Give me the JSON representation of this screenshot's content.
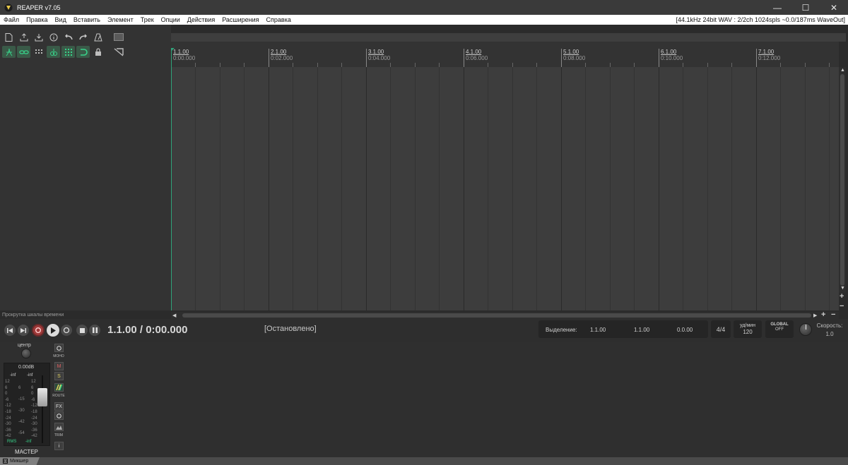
{
  "window": {
    "title": "REAPER v7.05",
    "controls": {
      "minimize": "—",
      "maximize": "☐",
      "close": "✕"
    }
  },
  "menu": {
    "items": [
      "Файл",
      "Правка",
      "Вид",
      "Вставить",
      "Элемент",
      "Трек",
      "Опции",
      "Действия",
      "Расширения",
      "Справка"
    ],
    "status": "[44.1kHz 24bit WAV : 2/2ch 1024spls ~0.0/187ms WaveOut]"
  },
  "toolbar": {
    "row1_icons": [
      "new-project-icon",
      "open-project-icon",
      "save-project-icon",
      "project-settings-icon",
      "undo-icon",
      "redo-icon",
      "metronome-icon",
      "grid-box-icon"
    ],
    "row2_icons": [
      "ripple-edit-icon",
      "link-icon",
      "snap-grid-icon",
      "auto-crossfade-icon",
      "grid-toggle-icon",
      "loop-icon",
      "lock-icon",
      "envelope-icon"
    ]
  },
  "ruler": {
    "marks": [
      {
        "bar": "1.1.00",
        "time": "0:00.000"
      },
      {
        "bar": "2.1.00",
        "time": "0:02.000"
      },
      {
        "bar": "3.1.00",
        "time": "0:04.000"
      },
      {
        "bar": "4.1.00",
        "time": "0:06.000"
      },
      {
        "bar": "5.1.00",
        "time": "0:08.000"
      },
      {
        "bar": "6.1.00",
        "time": "0:10.000"
      },
      {
        "bar": "7.1.00",
        "time": "0:12.000"
      }
    ]
  },
  "scrub_label": "Прокрутка шкалы времени",
  "transport": {
    "position": "1.1.00 / 0:00.000",
    "state": "[Остановлено]",
    "selection_label": "Выделение:",
    "selection_start": "1.1.00",
    "selection_end": "1.1.00",
    "selection_length": "0.0.00",
    "time_signature": "4/4",
    "bpm_label": "уд/мин",
    "bpm": "120",
    "global_label": "GLOBAL",
    "global_state": "OFF",
    "rate_label": "Скорость:",
    "rate": "1.0"
  },
  "master": {
    "pan_label": "центр",
    "volume": "0.00dB",
    "peak_left": "-inf",
    "peak_right": "-inf",
    "rms_label": "RMS",
    "rms_value": "-inf",
    "name": "МАСТЕР",
    "mono_label": "МОНО",
    "mute_label": "M",
    "solo_label": "S",
    "route_label": "ROUTE",
    "fx_label": "FX",
    "trim_label": "TRIM",
    "info_label": "i",
    "scale_left": [
      "12",
      "6",
      "0",
      "-6",
      "-12",
      "-18",
      "-24",
      "-30",
      "-36",
      "-42"
    ],
    "scale_mid": [
      "6",
      "-15",
      "-30",
      "-42",
      "-54"
    ],
    "scale_right": [
      "12",
      "6",
      "0",
      "-6",
      "-12",
      "-18",
      "-24",
      "-30",
      "-36",
      "-42"
    ],
    "scale_inner": [
      "-6",
      "-15",
      "-20",
      "-30",
      "-42",
      "-54"
    ]
  },
  "bottom": {
    "mixer_tab": "Микшер"
  },
  "colors": {
    "accent": "#2fa37a",
    "record": "#a03a3a",
    "background": "#2b2b2b"
  }
}
